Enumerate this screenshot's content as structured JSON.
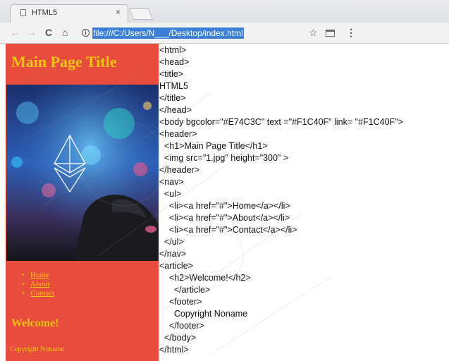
{
  "browser": {
    "tab_title": "HTML5",
    "tab_close": "×",
    "url": "file:///C:/Users/N___/Desktop/index.html",
    "icons": {
      "back": "←",
      "forward": "→",
      "reload": "C",
      "home": "⌂",
      "info": "i",
      "star": "☆",
      "menu": "⋮"
    }
  },
  "rendered_page": {
    "background": "#E74C3C",
    "text_color": "#F1C40F",
    "title": "Main Page Title",
    "nav_items": [
      "Home",
      "About",
      "Contact"
    ],
    "heading": "Welcome!",
    "footer": "Copyright Noname"
  },
  "source_code": [
    "<html>",
    "<head>",
    "<title>",
    "HTML5",
    "</title>",
    "</head>",
    "<body bgcolor=\"#E74C3C\" text =\"#F1C40F\" link= \"#F1C40F\">",
    "<header>",
    "  <h1>Main Page Title</h1>",
    "  <img src=\"1.jpg\" height=\"300\" >",
    "</header>",
    "<nav>",
    "  <ul>",
    "    <li><a href=\"#\">Home</a></li>",
    "    <li><a href=\"#\">About</a></li>",
    "    <li><a href=\"#\">Contact</a></li>",
    "  </ul>",
    "</nav>",
    "<article>",
    "    <h2>Welcome!</h2>",
    "      </article>",
    "    <footer>",
    "      Copyright Noname",
    "    </footer>",
    "  </body>",
    "</html>"
  ]
}
